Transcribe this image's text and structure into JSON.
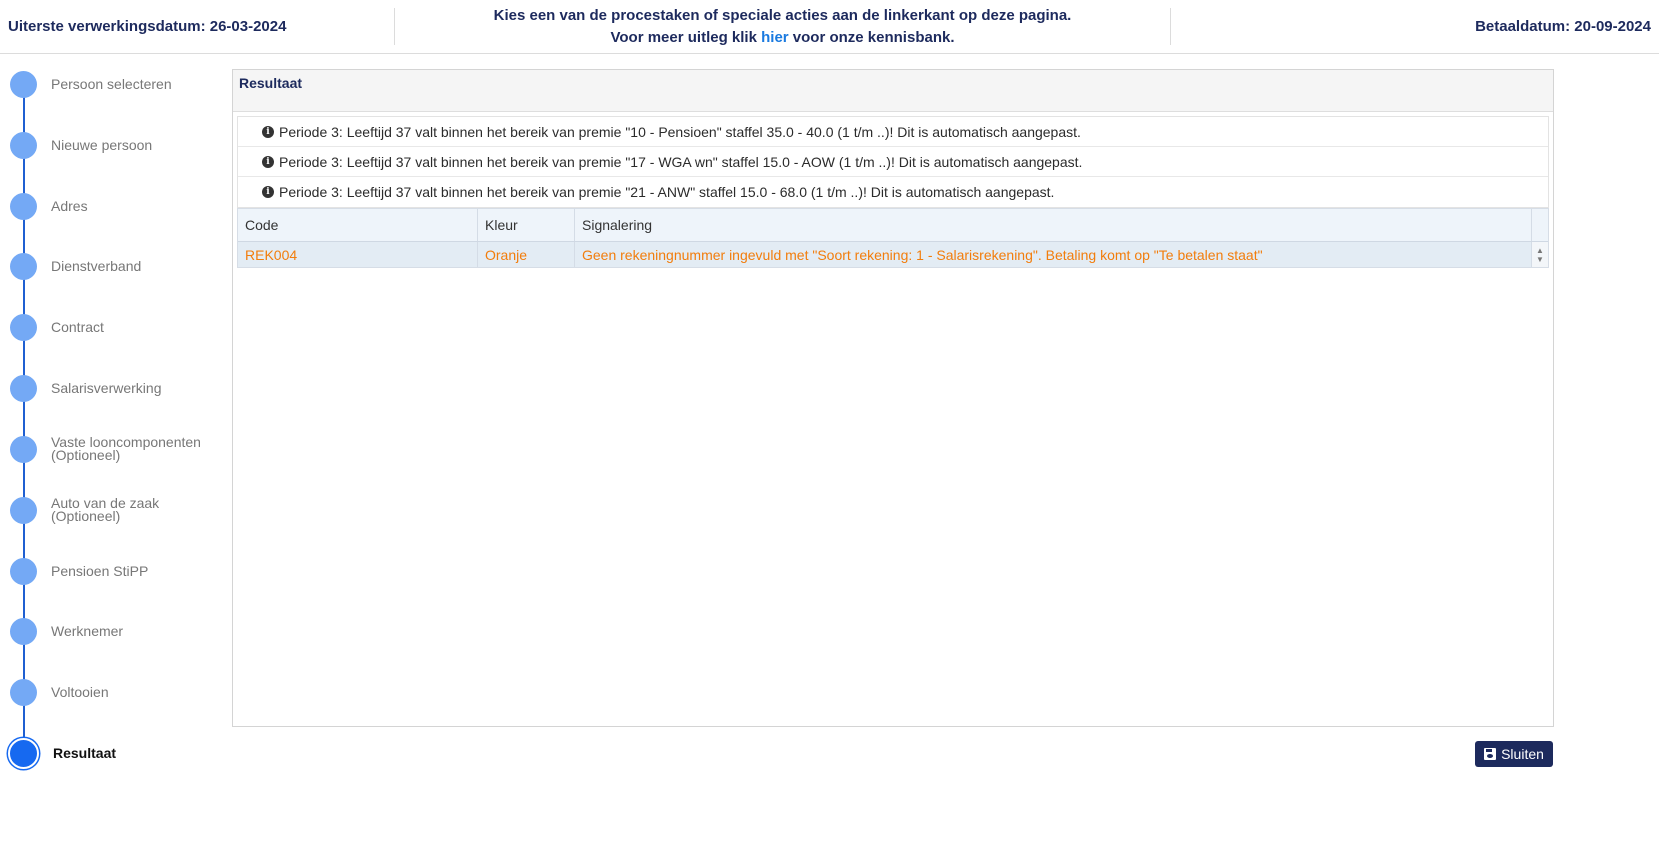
{
  "header": {
    "deadline": "Uiterste verwerkingsdatum: 26-03-2024",
    "instruction_line1": "Kies een van de procestaken of speciale acties aan de linkerkant op deze pagina.",
    "instruction_line2_prefix": "Voor meer uitleg klik ",
    "instruction_link": "hier",
    "instruction_line2_suffix": " voor onze kennisbank.",
    "payment_date": "Betaaldatum: 20-09-2024"
  },
  "steps": [
    {
      "label": "Persoon selecteren",
      "active": false
    },
    {
      "label": "Nieuwe persoon",
      "active": false
    },
    {
      "label": "Adres",
      "active": false
    },
    {
      "label": "Dienstverband",
      "active": false
    },
    {
      "label": "Contract",
      "active": false
    },
    {
      "label": "Salarisverwerking",
      "active": false
    },
    {
      "label": "Vaste looncomponenten\n(Optioneel)",
      "active": false
    },
    {
      "label": "Auto van de zaak\n(Optioneel)",
      "active": false
    },
    {
      "label": "Pensioen StiPP",
      "active": false
    },
    {
      "label": "Werknemer",
      "active": false
    },
    {
      "label": "Voltooien",
      "active": false
    },
    {
      "label": "Resultaat",
      "active": true
    }
  ],
  "result": {
    "title": "Resultaat",
    "messages": [
      "Periode 3: Leeftijd 37 valt binnen het bereik van premie \"10 - Pensioen\" staffel 35.0 - 40.0 (1 t/m ..)! Dit is automatisch aangepast.",
      "Periode 3: Leeftijd 37 valt binnen het bereik van premie \"17 - WGA wn\" staffel 15.0 - AOW (1 t/m ..)! Dit is automatisch aangepast.",
      "Periode 3: Leeftijd 37 valt binnen het bereik van premie \"21 - ANW\" staffel 15.0 - 68.0 (1 t/m ..)! Dit is automatisch aangepast."
    ],
    "table": {
      "columns": [
        "Code",
        "Kleur",
        "Signalering"
      ],
      "rows": [
        [
          "REK004",
          "Oranje",
          "Geen rekeningnummer ingevuld met \"Soort rekening: 1 - Salarisrekening\". Betaling komt op \"Te betalen staat\""
        ]
      ]
    }
  },
  "buttons": {
    "close_label": "Sluiten"
  },
  "colors": {
    "navy": "#1d2a5d",
    "step_dot": "#74a9f5",
    "step_active": "#1669f0",
    "signal_orange": "#f27d0c",
    "link_blue": "#1a7ae0"
  }
}
